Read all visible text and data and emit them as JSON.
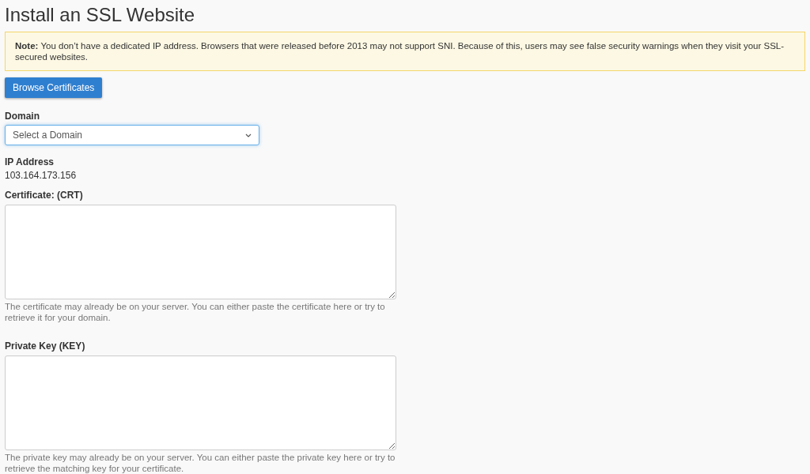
{
  "title": "Install an SSL Website",
  "note": "**Note:** You don’t have a dedicated IP address. Browsers that were released before 2013 may not support SNI. Because of this, users may see false security warnings when they visit your SSL-secured websites.",
  "browse_button": "Browse Certificates",
  "domain": {
    "label": "Domain",
    "placeholder": "Select a Domain"
  },
  "ip_address": {
    "label": "IP Address",
    "value": "103.164.173.156"
  },
  "certificate": {
    "label": "Certificate: (CRT)",
    "help": "The certificate may already be on your server. You can either paste the certificate here or try to retrieve it for your domain."
  },
  "private_key": {
    "label": "Private Key (KEY)",
    "help": "The private key may already be on your server. You can either paste the private key here or try to retrieve the matching key for your certificate."
  }
}
